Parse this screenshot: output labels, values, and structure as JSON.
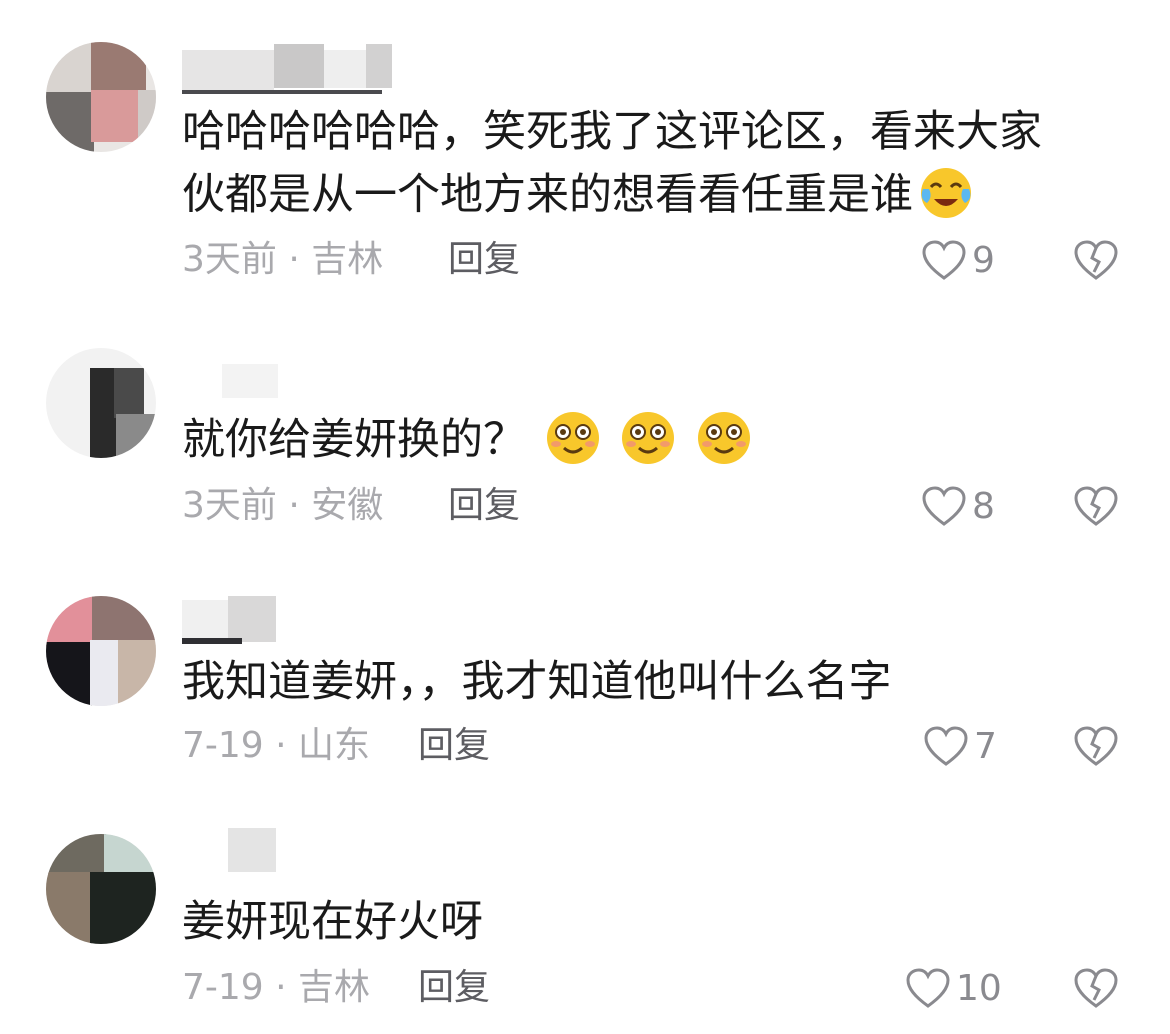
{
  "comments": [
    {
      "text": "哈哈哈哈哈哈，笑死我了这评论区，看来大家伙都是从一个地方来的想看看任重是谁",
      "emoji": "crying-laughing-emoji",
      "meta": "3天前 · 吉林",
      "reply": "回复",
      "likes": "9"
    },
    {
      "text": "就你给姜妍换的？",
      "emoji": "blushing-smile-emoji x3",
      "meta": "3天前 · 安徽",
      "reply": "回复",
      "likes": "8"
    },
    {
      "text": "我知道姜妍，，我才知道他叫什么名字",
      "meta": "7-19 · 山东",
      "reply": "回复",
      "likes": "7"
    },
    {
      "text": "姜妍现在好火呀",
      "meta": "7-19 · 吉林",
      "reply": "回复",
      "likes": "10"
    }
  ],
  "icons": {
    "like": "heart-outline-icon",
    "dislike": "broken-heart-icon"
  },
  "colors": {
    "text": "#1a1a1a",
    "meta": "#a9a9ad",
    "reply": "#5d5d62",
    "icon": "#8a8a8f"
  }
}
